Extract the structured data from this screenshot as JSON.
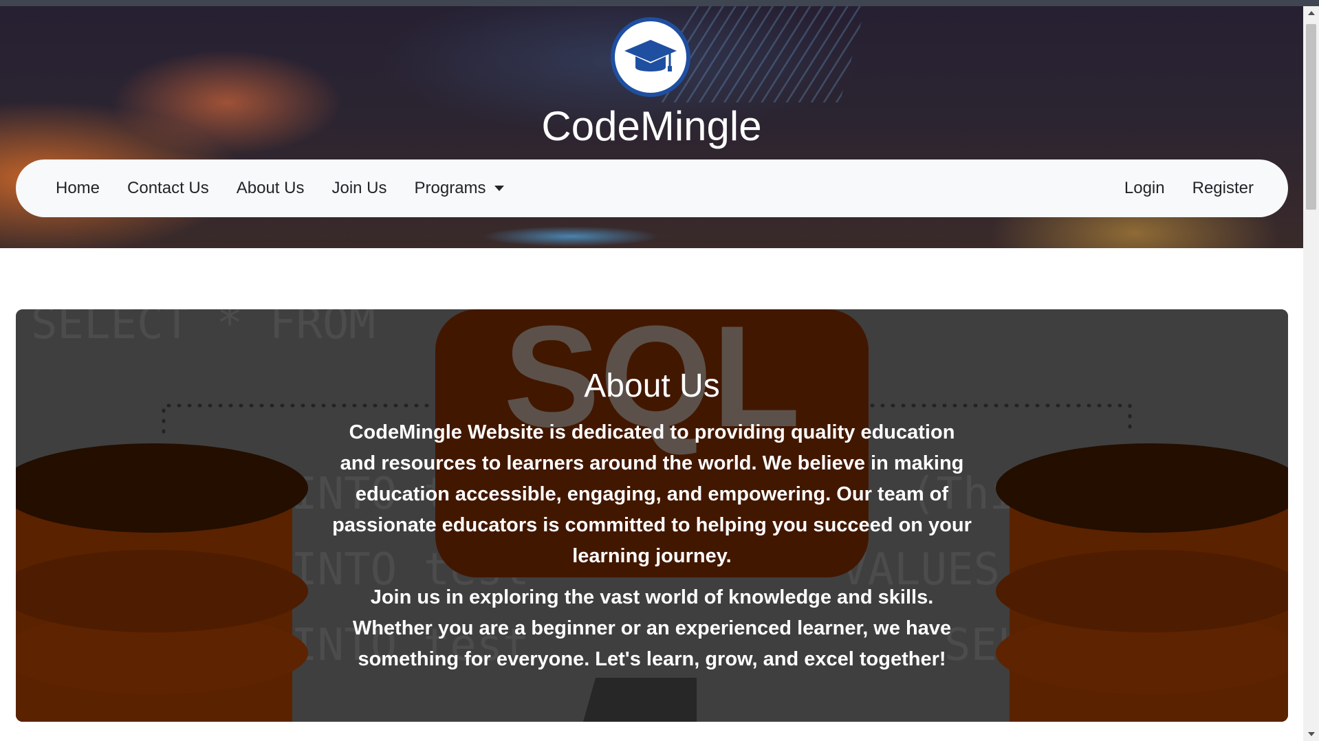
{
  "brand": {
    "name": "CodeMingle",
    "logo_icon": "graduation-cap-icon"
  },
  "nav": {
    "left": [
      "Home",
      "Contact Us",
      "About Us",
      "Join Us"
    ],
    "programs": "Programs",
    "right": [
      "Login",
      "Register"
    ]
  },
  "about": {
    "title": "About Us",
    "paragraphs": [
      "CodeMingle Website is dedicated to providing quality education and resources to learners around the world. We believe in making education accessible, engaging, and empowering. Our team of passionate educators is committed to helping you succeed on your learning journey.",
      "Join us in exploring the vast world of knowledge and skills. Whether you are a beginner or an experienced learner, we have something for everyone. Let's learn, grow, and excel together!"
    ],
    "background": {
      "badge_text": "SQL",
      "code_lines": [
        "SELECT * FROM",
        "INTO t",
        "(Thi",
        "INTO test",
        "VALUES",
        "INTO test",
        "SEL"
      ]
    }
  },
  "colors": {
    "logo_blue": "#1f4fa0",
    "navbar_bg": "#f8f9fa",
    "text_dark": "#212529",
    "sql_orange": "#b74500"
  }
}
